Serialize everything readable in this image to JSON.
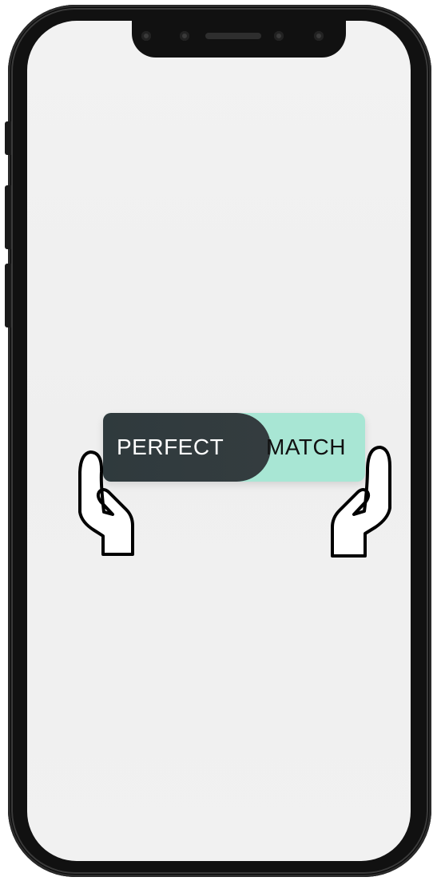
{
  "device": {
    "type": "smartphone",
    "frame_color": "#111111",
    "screen_color": "#f0f0f0"
  },
  "badge": {
    "left_text": "PERFECT",
    "right_text": "MATCH",
    "left_color": "#343c3f",
    "right_color": "#a8e6d4"
  },
  "icons": {
    "left_hand": "hand-left-icon",
    "right_hand": "hand-right-icon"
  }
}
